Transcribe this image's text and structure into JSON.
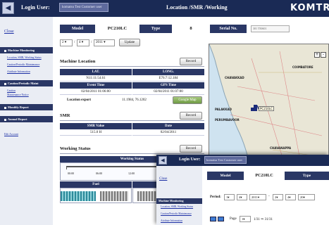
{
  "header": {
    "back_icon": "◀",
    "user_label": "Login User:",
    "user_value": "komatsu Test Customer user",
    "page_title": "Location /SMR /Working",
    "logo": "KOMTRAX"
  },
  "sidebar": {
    "close": "Close",
    "sections": [
      {
        "title": "Machine Monitoring",
        "links": [
          "Location, SMR, Working Status",
          "Caution/Periodic Maintenance",
          "Attribute Information"
        ]
      },
      {
        "title": "Caution/Periodic Maint",
        "links": [
          "Caution",
          "Maintenance Notice"
        ]
      }
    ],
    "monthly_report": "Monthly Report",
    "annual_report": "Annual Report",
    "edit_account": "Edit Account"
  },
  "machine": {
    "model_label": "Model",
    "model_value": "PC210LC",
    "type_label": "Type",
    "type_value": "8",
    "serial_label": "Serial No.",
    "serial_value": "301 T50601"
  },
  "date_selector": {
    "month": "2",
    "day": "4",
    "year": "2011",
    "update_button": "Update"
  },
  "location": {
    "title": "Machine Location",
    "record_button": "Record",
    "lat_label": "LAT.",
    "long_label": "LONG.",
    "lat_value": "N11:11:54.61",
    "long_value": "E76:7:12.184",
    "event_label": "Event Time",
    "gps_label": "GPS Time",
    "event_value": "02/04/2011 01:06:00",
    "gps_value": "02/04/2011 01:07:00",
    "export_label": "Location export",
    "export_value": "11.1984, 76.1202",
    "google_button": "Google Map"
  },
  "smr": {
    "title": "SMR",
    "record_button": "Record",
    "value_label": "SMR Value",
    "date_label": "Date",
    "value": "515.0 H",
    "date": "02/04/2011"
  },
  "working": {
    "title": "Working Status",
    "record_button": "Record",
    "chart_header": "Working Status",
    "ticks": [
      "00:00",
      "06:00",
      "12:00"
    ],
    "fuel_label": "Fuel",
    "water_label": "Water Temp."
  },
  "map": {
    "tools": [
      "+",
      "-"
    ],
    "places": [
      "CHAVAKKAD",
      "COIMBATORE",
      "PALAKKAD",
      "PERUMBAVOOR",
      "CHAVANAPPA",
      "COCHIN",
      "PAMBAR"
    ],
    "marker_label": "PC210LC"
  },
  "overlay": {
    "back_icon": "◀",
    "user_label": "Login User:",
    "user_value": "komatsu Test Customer user",
    "close": "Close",
    "section_title": "Machine Monitoring",
    "links": [
      "Location, SMR, Working Status",
      "Caution/Periodic Maintenance",
      "Attribute Information"
    ],
    "model_label": "Model",
    "model_value": "PC210LC",
    "type_label": "Type",
    "period_label": "Period:",
    "from_month": "1",
    "from_day": "4",
    "from_year": "2011",
    "to_month": "2",
    "to_day": "4",
    "to_year": "20",
    "page_label": "Page",
    "page_value": "1",
    "page_range": "1/31 ⇒ 31/31"
  }
}
